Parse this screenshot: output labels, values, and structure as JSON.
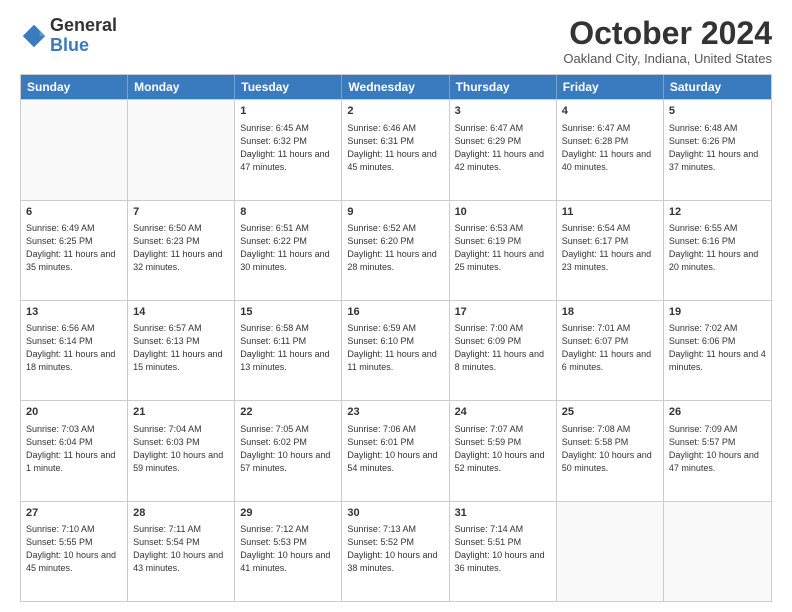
{
  "logo": {
    "general": "General",
    "blue": "Blue"
  },
  "title": "October 2024",
  "location": "Oakland City, Indiana, United States",
  "days_of_week": [
    "Sunday",
    "Monday",
    "Tuesday",
    "Wednesday",
    "Thursday",
    "Friday",
    "Saturday"
  ],
  "weeks": [
    [
      {
        "day": "",
        "empty": true
      },
      {
        "day": "",
        "empty": true
      },
      {
        "day": "1",
        "sunrise": "6:45 AM",
        "sunset": "6:32 PM",
        "daylight": "11 hours and 47 minutes."
      },
      {
        "day": "2",
        "sunrise": "6:46 AM",
        "sunset": "6:31 PM",
        "daylight": "11 hours and 45 minutes."
      },
      {
        "day": "3",
        "sunrise": "6:47 AM",
        "sunset": "6:29 PM",
        "daylight": "11 hours and 42 minutes."
      },
      {
        "day": "4",
        "sunrise": "6:47 AM",
        "sunset": "6:28 PM",
        "daylight": "11 hours and 40 minutes."
      },
      {
        "day": "5",
        "sunrise": "6:48 AM",
        "sunset": "6:26 PM",
        "daylight": "11 hours and 37 minutes."
      }
    ],
    [
      {
        "day": "6",
        "sunrise": "6:49 AM",
        "sunset": "6:25 PM",
        "daylight": "11 hours and 35 minutes."
      },
      {
        "day": "7",
        "sunrise": "6:50 AM",
        "sunset": "6:23 PM",
        "daylight": "11 hours and 32 minutes."
      },
      {
        "day": "8",
        "sunrise": "6:51 AM",
        "sunset": "6:22 PM",
        "daylight": "11 hours and 30 minutes."
      },
      {
        "day": "9",
        "sunrise": "6:52 AM",
        "sunset": "6:20 PM",
        "daylight": "11 hours and 28 minutes."
      },
      {
        "day": "10",
        "sunrise": "6:53 AM",
        "sunset": "6:19 PM",
        "daylight": "11 hours and 25 minutes."
      },
      {
        "day": "11",
        "sunrise": "6:54 AM",
        "sunset": "6:17 PM",
        "daylight": "11 hours and 23 minutes."
      },
      {
        "day": "12",
        "sunrise": "6:55 AM",
        "sunset": "6:16 PM",
        "daylight": "11 hours and 20 minutes."
      }
    ],
    [
      {
        "day": "13",
        "sunrise": "6:56 AM",
        "sunset": "6:14 PM",
        "daylight": "11 hours and 18 minutes."
      },
      {
        "day": "14",
        "sunrise": "6:57 AM",
        "sunset": "6:13 PM",
        "daylight": "11 hours and 15 minutes."
      },
      {
        "day": "15",
        "sunrise": "6:58 AM",
        "sunset": "6:11 PM",
        "daylight": "11 hours and 13 minutes."
      },
      {
        "day": "16",
        "sunrise": "6:59 AM",
        "sunset": "6:10 PM",
        "daylight": "11 hours and 11 minutes."
      },
      {
        "day": "17",
        "sunrise": "7:00 AM",
        "sunset": "6:09 PM",
        "daylight": "11 hours and 8 minutes."
      },
      {
        "day": "18",
        "sunrise": "7:01 AM",
        "sunset": "6:07 PM",
        "daylight": "11 hours and 6 minutes."
      },
      {
        "day": "19",
        "sunrise": "7:02 AM",
        "sunset": "6:06 PM",
        "daylight": "11 hours and 4 minutes."
      }
    ],
    [
      {
        "day": "20",
        "sunrise": "7:03 AM",
        "sunset": "6:04 PM",
        "daylight": "11 hours and 1 minute."
      },
      {
        "day": "21",
        "sunrise": "7:04 AM",
        "sunset": "6:03 PM",
        "daylight": "10 hours and 59 minutes."
      },
      {
        "day": "22",
        "sunrise": "7:05 AM",
        "sunset": "6:02 PM",
        "daylight": "10 hours and 57 minutes."
      },
      {
        "day": "23",
        "sunrise": "7:06 AM",
        "sunset": "6:01 PM",
        "daylight": "10 hours and 54 minutes."
      },
      {
        "day": "24",
        "sunrise": "7:07 AM",
        "sunset": "5:59 PM",
        "daylight": "10 hours and 52 minutes."
      },
      {
        "day": "25",
        "sunrise": "7:08 AM",
        "sunset": "5:58 PM",
        "daylight": "10 hours and 50 minutes."
      },
      {
        "day": "26",
        "sunrise": "7:09 AM",
        "sunset": "5:57 PM",
        "daylight": "10 hours and 47 minutes."
      }
    ],
    [
      {
        "day": "27",
        "sunrise": "7:10 AM",
        "sunset": "5:55 PM",
        "daylight": "10 hours and 45 minutes."
      },
      {
        "day": "28",
        "sunrise": "7:11 AM",
        "sunset": "5:54 PM",
        "daylight": "10 hours and 43 minutes."
      },
      {
        "day": "29",
        "sunrise": "7:12 AM",
        "sunset": "5:53 PM",
        "daylight": "10 hours and 41 minutes."
      },
      {
        "day": "30",
        "sunrise": "7:13 AM",
        "sunset": "5:52 PM",
        "daylight": "10 hours and 38 minutes."
      },
      {
        "day": "31",
        "sunrise": "7:14 AM",
        "sunset": "5:51 PM",
        "daylight": "10 hours and 36 minutes."
      },
      {
        "day": "",
        "empty": true
      },
      {
        "day": "",
        "empty": true
      }
    ]
  ]
}
